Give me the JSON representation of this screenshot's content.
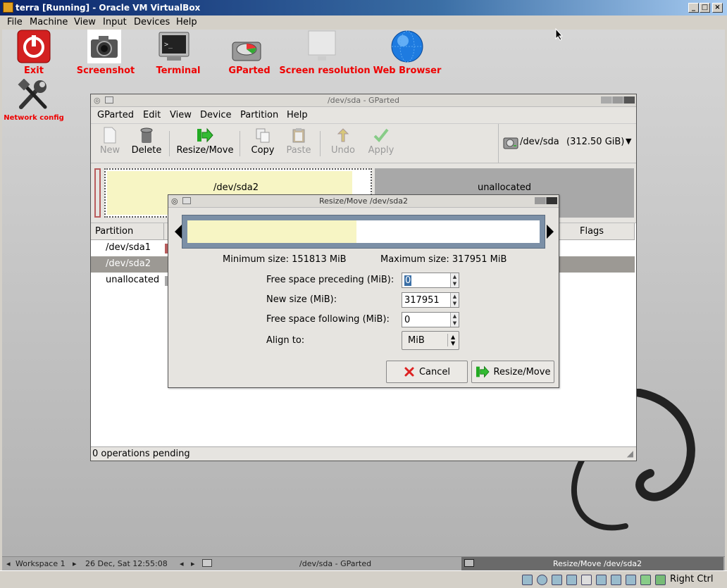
{
  "host": {
    "title": "terra [Running] - Oracle VM VirtualBox",
    "menu": [
      "File",
      "Machine",
      "View",
      "Input",
      "Devices",
      "Help"
    ],
    "host_key": "Right Ctrl"
  },
  "desktop_icons": [
    {
      "label": "Exit",
      "icon": "power-icon"
    },
    {
      "label": "Screenshot",
      "icon": "camera-icon"
    },
    {
      "label": "Terminal",
      "icon": "terminal-icon"
    },
    {
      "label": "GParted",
      "icon": "gparted-icon"
    },
    {
      "label": "Screen resolution",
      "icon": "monitor-icon"
    },
    {
      "label": "Web Browser",
      "icon": "globe-icon"
    },
    {
      "label": "Network config",
      "icon": "tools-icon"
    }
  ],
  "gparted": {
    "title": "/dev/sda - GParted",
    "menu": [
      "GParted",
      "Edit",
      "View",
      "Device",
      "Partition",
      "Help"
    ],
    "toolbar": {
      "new": "New",
      "delete": "Delete",
      "resize": "Resize/Move",
      "copy": "Copy",
      "paste": "Paste",
      "undo": "Undo",
      "apply": "Apply"
    },
    "device": "/dev/sda",
    "device_size": "(312.50 GiB)",
    "graph": {
      "sda2_label": "/dev/sda2",
      "unallocated_label": "unallocated"
    },
    "columns": {
      "partition": "Partition",
      "flags": "Flags"
    },
    "rows": [
      "/dev/sda1",
      "/dev/sda2",
      "unallocated"
    ],
    "status": "0 operations pending"
  },
  "dialog": {
    "title": "Resize/Move /dev/sda2",
    "min_size": "Minimum size: 151813 MiB",
    "max_size": "Maximum size: 317951 MiB",
    "used_fraction": 0.48,
    "fields": {
      "preceding_label": "Free space preceding (MiB):",
      "preceding_value": "0",
      "newsize_label": "New size (MiB):",
      "newsize_value": "317951",
      "following_label": "Free space following (MiB):",
      "following_value": "0",
      "align_label": "Align to:",
      "align_value": "MiB"
    },
    "cancel": "Cancel",
    "resize": "Resize/Move"
  },
  "taskbar": {
    "workspace": "Workspace 1",
    "datetime": "26 Dec, Sat 12:55:08",
    "task1": "/dev/sda - GParted",
    "task2": "Resize/Move /dev/sda2"
  }
}
